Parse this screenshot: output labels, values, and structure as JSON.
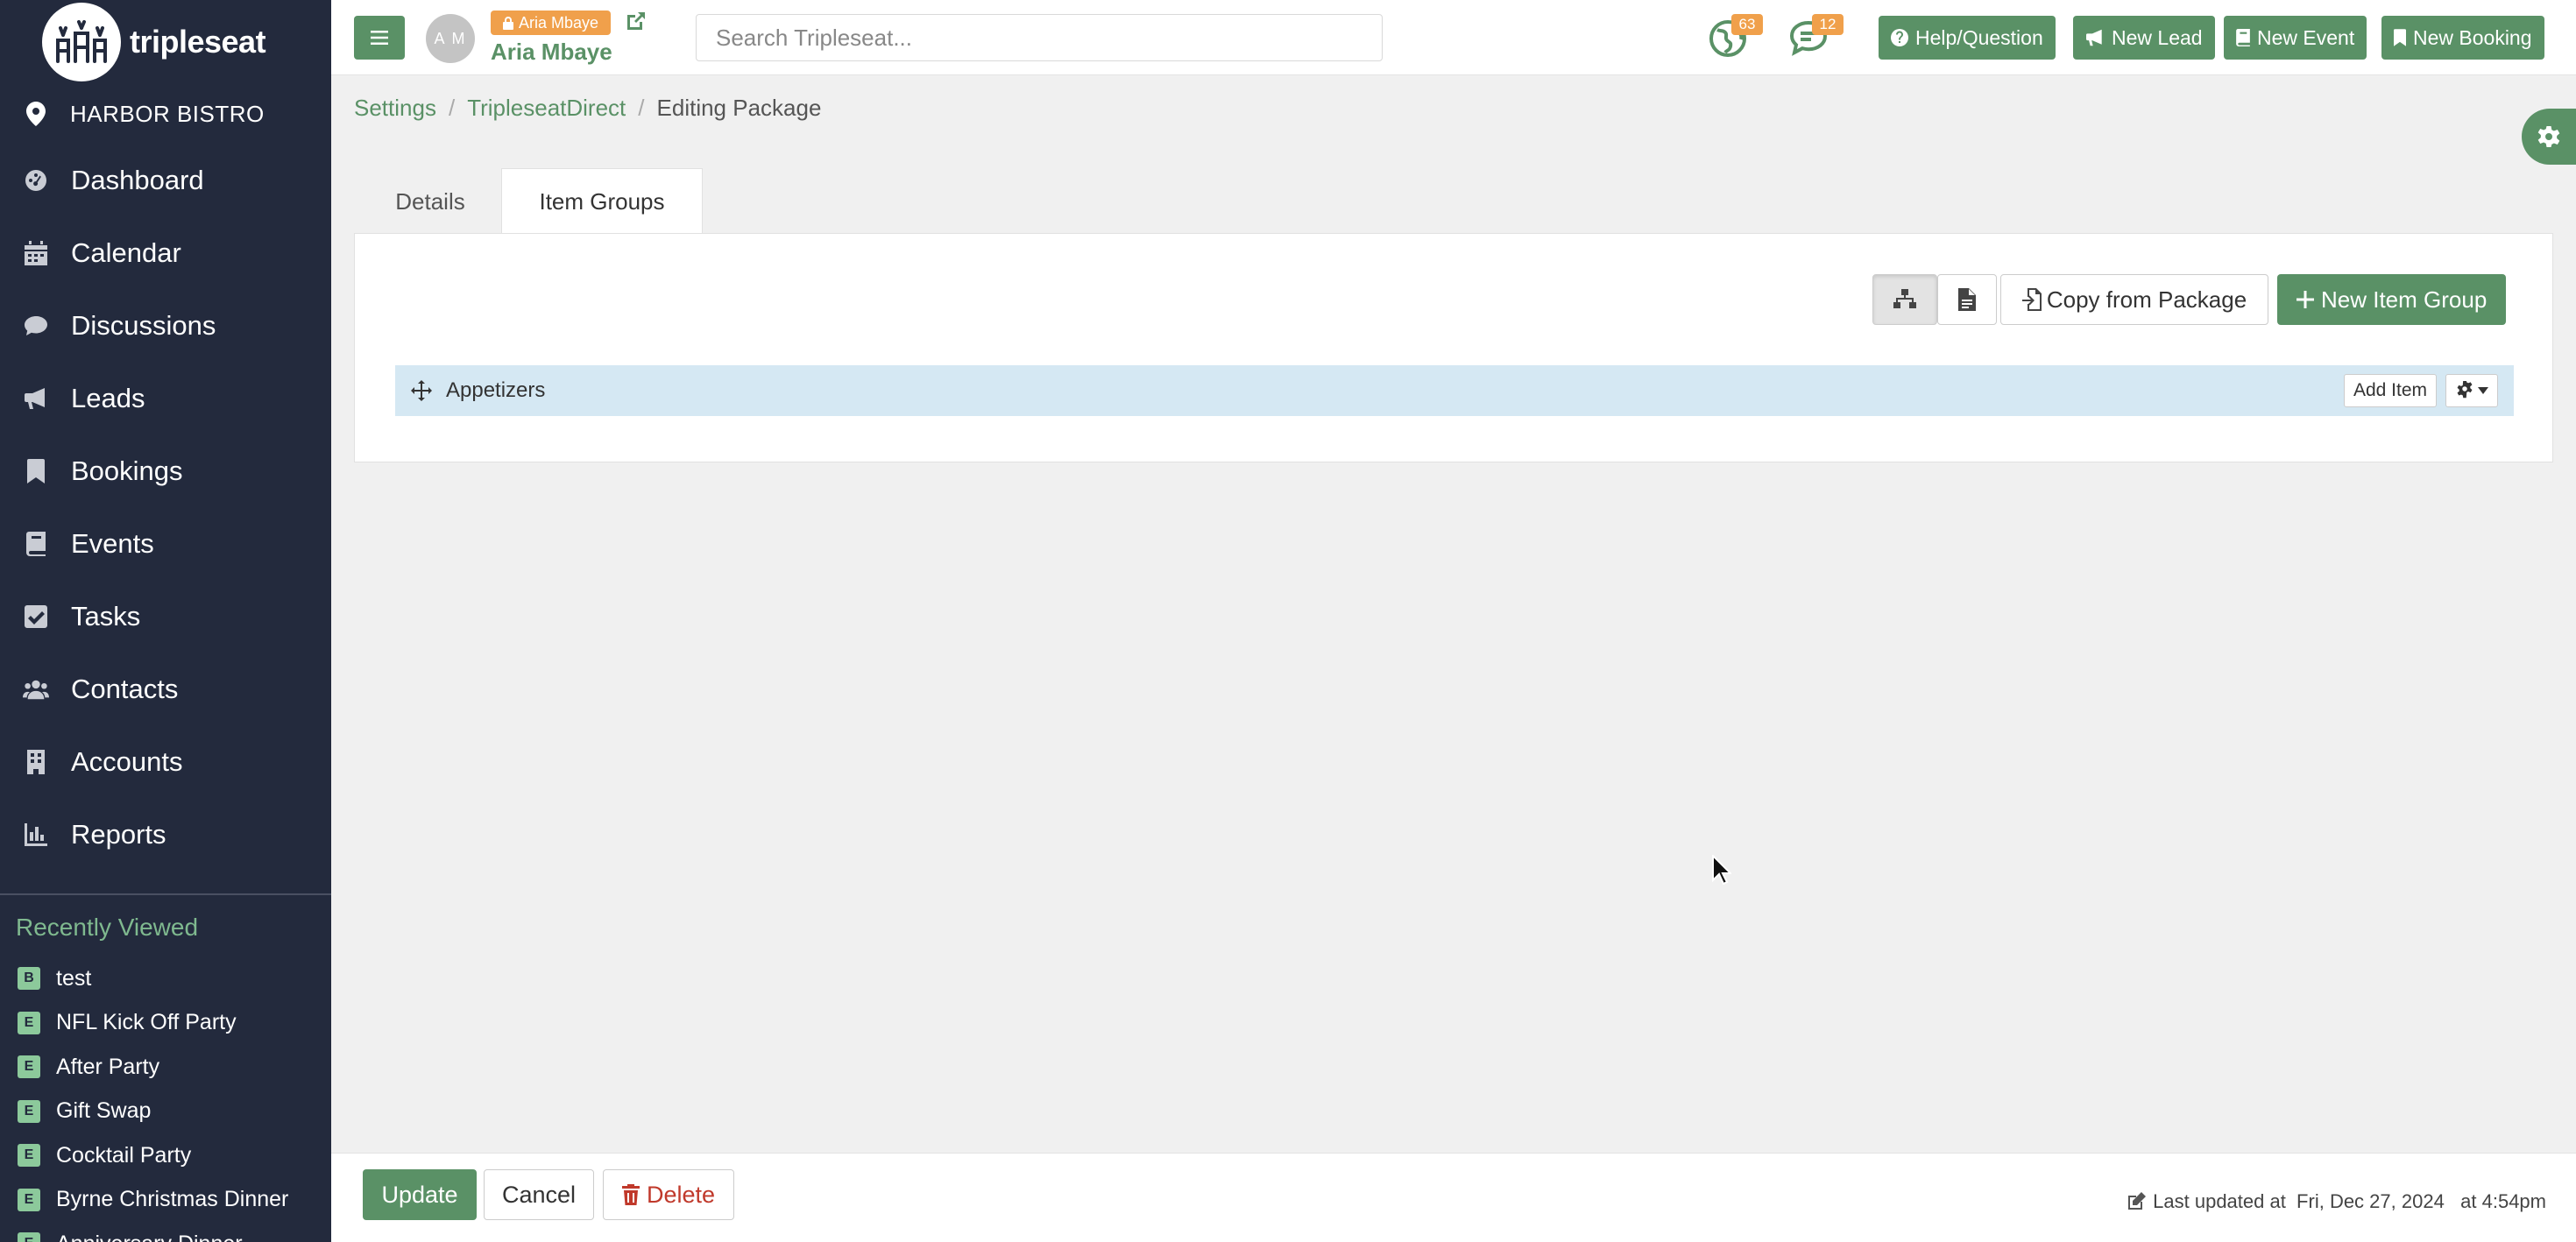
{
  "brand": {
    "name": "tripleseat"
  },
  "location": {
    "name": "HARBOR BISTRO"
  },
  "nav": {
    "items": [
      {
        "label": "Dashboard",
        "icon": "dashboard-icon"
      },
      {
        "label": "Calendar",
        "icon": "calendar-icon"
      },
      {
        "label": "Discussions",
        "icon": "discussions-icon"
      },
      {
        "label": "Leads",
        "icon": "megaphone-icon"
      },
      {
        "label": "Bookings",
        "icon": "bookmark-icon"
      },
      {
        "label": "Events",
        "icon": "book-icon"
      },
      {
        "label": "Tasks",
        "icon": "check-square-icon"
      },
      {
        "label": "Contacts",
        "icon": "users-icon"
      },
      {
        "label": "Accounts",
        "icon": "building-icon"
      },
      {
        "label": "Reports",
        "icon": "chart-icon"
      }
    ]
  },
  "recent": {
    "title": "Recently Viewed",
    "items": [
      {
        "badge": "B",
        "label": "test"
      },
      {
        "badge": "E",
        "label": "NFL Kick Off Party"
      },
      {
        "badge": "E",
        "label": "After Party"
      },
      {
        "badge": "E",
        "label": "Gift Swap"
      },
      {
        "badge": "E",
        "label": "Cocktail Party"
      },
      {
        "badge": "E",
        "label": "Byrne Christmas Dinner"
      },
      {
        "badge": "E",
        "label": "Anniversary Dinner"
      }
    ]
  },
  "topbar": {
    "avatar_initials": "A M",
    "user_badge": "Aria Mbaye",
    "user_name": "Aria Mbaye",
    "search_placeholder": "Search Tripleseat...",
    "globe_count": "63",
    "chat_count": "12",
    "help_label": "Help/Question",
    "new_lead_label": "New Lead",
    "new_event_label": "New Event",
    "new_booking_label": "New Booking"
  },
  "breadcrumb": {
    "settings": "Settings",
    "tripleseat_direct": "TripleseatDirect",
    "current": "Editing Package"
  },
  "tabs": {
    "details": "Details",
    "item_groups": "Item Groups"
  },
  "panel": {
    "copy_label": "Copy from Package",
    "new_group_label": "New Item Group",
    "group_name": "Appetizers",
    "add_item_label": "Add Item"
  },
  "footer": {
    "update_label": "Update",
    "cancel_label": "Cancel",
    "delete_label": "Delete",
    "last_updated": "Last updated at  Fri, Dec 27, 2024   at 4:54pm"
  },
  "colors": {
    "sidebar": "#232a3d",
    "brand_green": "#5a9166",
    "badge_orange": "#f0a04b",
    "group_row": "#d5e8f3"
  }
}
